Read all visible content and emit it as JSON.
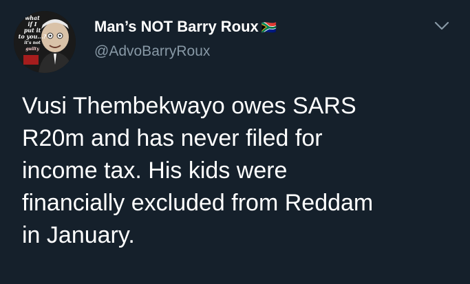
{
  "tweet": {
    "display_name": "Man’s NOT Barry Roux",
    "name_badge": "🇿🇦",
    "handle": "@AdvoBarryRoux",
    "text": "Vusi Thembekwayo owes SARS\nR20m and has never filed for\nincome tax. His kids were\nfinancially excluded from Reddam\nin January.",
    "avatar_caption": [
      "what",
      "if I",
      "put it",
      "to you...?",
      "it's not",
      "guilty"
    ]
  },
  "icons": {
    "menu": "chevron-down-icon"
  },
  "colors": {
    "background": "#15202b",
    "text": "#ffffff",
    "secondary_text": "#8899a6"
  }
}
